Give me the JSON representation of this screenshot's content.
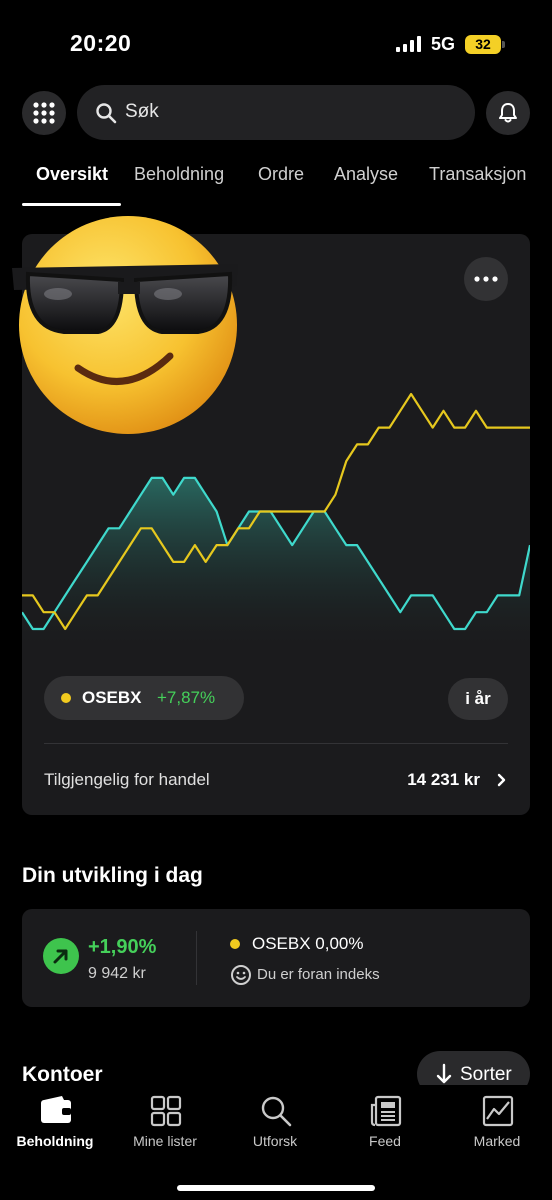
{
  "status_bar": {
    "time": "20:20",
    "network": "5G",
    "battery": "32"
  },
  "search": {
    "placeholder": "Søk"
  },
  "tabs": [
    {
      "label": "Oversikt",
      "active": true
    },
    {
      "label": "Beholdning"
    },
    {
      "label": "Ordre"
    },
    {
      "label": "Analyse"
    },
    {
      "label": "Transaksjon"
    }
  ],
  "overview": {
    "index_name": "OSEBX",
    "index_change": "+7,87%",
    "period": "i år",
    "available_label": "Tilgjengelig for handel",
    "available_value": "14 231 kr"
  },
  "chart_data": {
    "type": "line",
    "series": [
      {
        "color": "#3fd9cc",
        "values": [
          1,
          0,
          0,
          1,
          2,
          3,
          4,
          5,
          6,
          6,
          7,
          8,
          9,
          9,
          8,
          9,
          9,
          8,
          7,
          5,
          6,
          7,
          7,
          7,
          6,
          5,
          6,
          7,
          7,
          6,
          5,
          5,
          4,
          3,
          2,
          1,
          2,
          2,
          2,
          1,
          0,
          0,
          1,
          1,
          2,
          2,
          2,
          5
        ]
      },
      {
        "color": "#e6c81e",
        "values": [
          2,
          2,
          1,
          1,
          0,
          1,
          2,
          2,
          3,
          4,
          5,
          6,
          6,
          5,
          4,
          4,
          5,
          4,
          5,
          5,
          6,
          6,
          7,
          7,
          7,
          7,
          7,
          7,
          7,
          8,
          10,
          11,
          11,
          12,
          12,
          13,
          14,
          13,
          12,
          13,
          12,
          12,
          13,
          12,
          12,
          12,
          12,
          12
        ]
      }
    ],
    "colors": {
      "portfolio": "#3fd9cc",
      "index": "#e6c81e"
    }
  },
  "development": {
    "title": "Din utvikling i dag",
    "change": "+1,90%",
    "amount": "9 942 kr",
    "index_text": "OSEBX 0,00%",
    "status": "Du er foran indeks"
  },
  "accounts": {
    "title": "Kontoer",
    "sort_label": "Sorter"
  },
  "bottom_nav": [
    {
      "label": "Beholdning",
      "icon": "wallet-icon",
      "active": true
    },
    {
      "label": "Mine lister",
      "icon": "grid-list-icon"
    },
    {
      "label": "Utforsk",
      "icon": "search-icon"
    },
    {
      "label": "Feed",
      "icon": "newspaper-icon"
    },
    {
      "label": "Marked",
      "icon": "chart-icon"
    }
  ],
  "colors": {
    "positive": "#45d05a",
    "index_yellow": "#f2cb1f",
    "accent_teal": "#3fd9cc"
  }
}
